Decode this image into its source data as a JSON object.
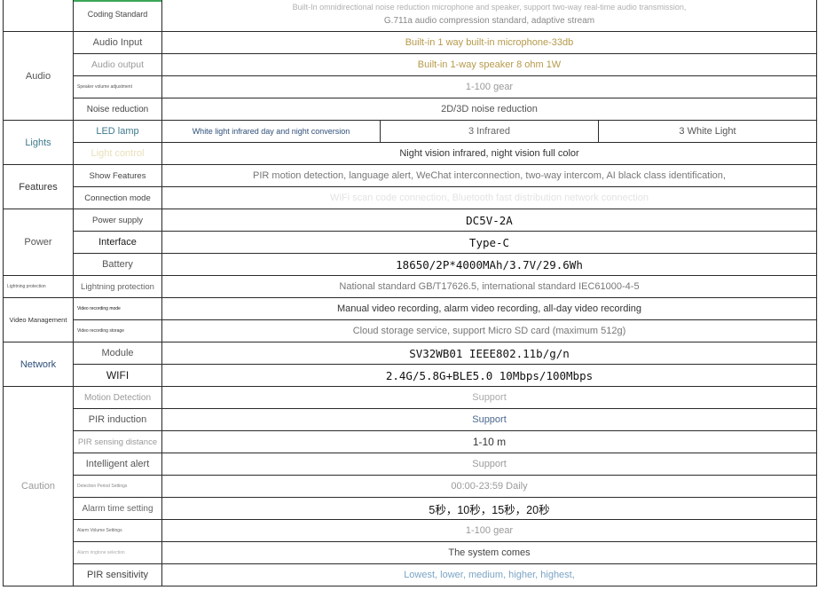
{
  "rows": {
    "coding_standard": {
      "label": "Coding Standard",
      "value_line1": "Built-In omnidirectional noise reduction microphone and speaker, support two-way real-time audio transmission,",
      "value_line2": "G.711a audio compression standard, adaptive stream"
    },
    "audio": {
      "category": "Audio",
      "input_label": "Audio Input",
      "input_value": "Built-in 1 way built-in microphone-33db",
      "output_label": "Audio output",
      "output_value": "Built-in 1-way speaker 8 ohm 1W",
      "volume_label": "Speaker volume adjustment",
      "volume_value": "1-100 gear",
      "noise_label": "Noise reduction",
      "noise_value": "2D/3D noise reduction"
    },
    "lights": {
      "category": "Lights",
      "led_label": "LED lamp",
      "led_v1": "White light infrared day and night conversion",
      "led_v2": "3 Infrared",
      "led_v3": "3 White Light",
      "control_label": "Light control",
      "control_value": "Night vision infrared, night vision full color"
    },
    "features": {
      "category": "Features",
      "show_label": "Show Features",
      "show_value": "PIR motion detection, language alert, WeChat interconnection, two-way intercom, AI black class identification,",
      "conn_label": "Connection mode",
      "conn_value": "WiFi scan code connection, Bluetooth fast distribution network connection"
    },
    "power": {
      "category": "Power",
      "supply_label": "Power supply",
      "supply_value": "DC5V-2A",
      "interface_label": "Interface",
      "interface_value": "Type-C",
      "battery_label": "Battery",
      "battery_value": "18650/2P*4000MAh/3.7V/29.6Wh"
    },
    "lightning": {
      "category": "Lightning protection",
      "label": "Lightning protection",
      "value": "National standard GB/T17626.5, international standard IEC61000-4-5"
    },
    "video": {
      "category": "Video Management",
      "mode_label": "Video recording mode",
      "mode_value": "Manual video recording, alarm video recording, all-day video recording",
      "storage_label": "Video recording storage",
      "storage_value": "Cloud storage service, support Micro SD card (maximum 512g)"
    },
    "network": {
      "category": "Network",
      "module_label": "Module",
      "module_value": "SV32WB01  IEEE802.11b/g/n",
      "wifi_label": "WIFI",
      "wifi_value": "2.4G/5.8G+BLE5.0  10Mbps/100Mbps"
    },
    "caution": {
      "category": "Caution",
      "motion_label": "Motion Detection",
      "motion_value": "Support",
      "pir_label": "PIR induction",
      "pir_value": "Support",
      "distance_label": "PIR sensing distance",
      "distance_value": "1-10 m",
      "alert_label": "Intelligent alert",
      "alert_value": "Support",
      "period_label": "Detection Period Settings",
      "period_value": "00:00-23:59 Daily",
      "alarm_time_label": "Alarm time setting",
      "alarm_time_value": "5秒，10秒，15秒，20秒",
      "alarm_vol_label": "Alarm Volume Settings",
      "alarm_vol_value": "1-100 gear",
      "ringtone_label": "Alarm ringtone selection",
      "ringtone_value": "The system comes",
      "sensitivity_label": "PIR sensitivity",
      "sensitivity_value": "Lowest, lower, medium, higher, highest,"
    }
  }
}
